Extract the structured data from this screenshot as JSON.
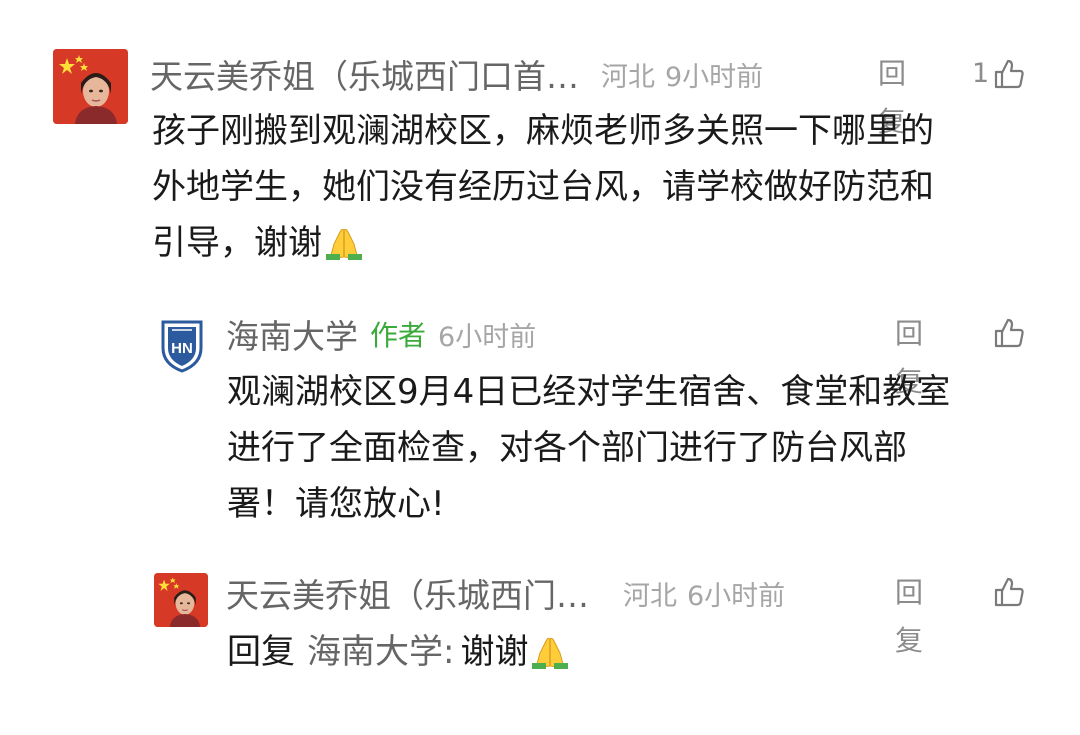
{
  "comments": [
    {
      "username": "天云美乔姐（乐城西门口首…",
      "location": "河北",
      "time": "9小时前",
      "reply_label": "回复",
      "like_count": "1",
      "text_lines": [
        "孩子刚搬到观澜湖校区，麻烦老师多关照一下哪里的",
        "外地学生，她们没有经历过台风，请学校做好防范和",
        "引导，谢谢"
      ],
      "emoji": "pray-emoji"
    },
    {
      "username": "海南大学",
      "author_badge": "作者",
      "time": "6小时前",
      "reply_label": "回复",
      "avatar_logo_text": "HN",
      "text_lines": [
        "观澜湖校区9月4日已经对学生宿舍、食堂和教室",
        "进行了全面检查，对各个部门进行了防台风部",
        "署！请您放心!"
      ]
    },
    {
      "username": "天云美乔姐（乐城西门…",
      "location": "河北",
      "time": "6小时前",
      "reply_label": "回复",
      "reply_prefix": "回复",
      "reply_to": "海南大学:",
      "reply_text": "谢谢",
      "emoji": "pray-emoji"
    }
  ],
  "colors": {
    "username": "#666666",
    "meta": "#a6a6a6",
    "author_badge": "#3aaa3a",
    "body": "#1a1a1a",
    "action": "#8c8c8c"
  },
  "icons": {
    "like": "thumbs-up-icon",
    "emoji": "folded-hands-icon"
  }
}
